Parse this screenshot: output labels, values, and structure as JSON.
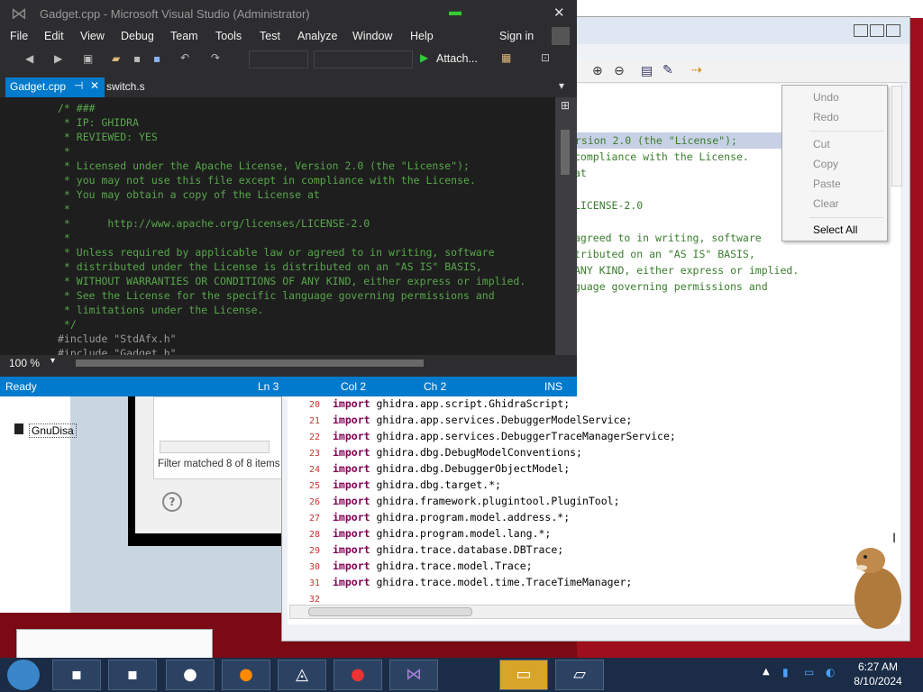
{
  "vs": {
    "title": "Gadget.cpp - Microsoft Visual Studio (Administrator)",
    "menu": [
      "File",
      "Edit",
      "View",
      "Debug",
      "Team",
      "Tools",
      "Test",
      "Analyze",
      "Window",
      "Help"
    ],
    "sign_in": "Sign in",
    "attach_label": "Attach...",
    "tabs": [
      {
        "label": "Gadget.cpp"
      },
      {
        "label": "switch.s"
      }
    ],
    "code_lines": [
      {
        "text": "/* ###",
        "cls": "cm"
      },
      {
        "text": " * IP: GHIDRA",
        "cls": "cm"
      },
      {
        "text": " * REVIEWED: YES",
        "cls": "cm"
      },
      {
        "text": " *",
        "cls": "cm"
      },
      {
        "text": " * Licensed under the Apache License, Version 2.0 (the \"License\");",
        "cls": "cm"
      },
      {
        "text": " * you may not use this file except in compliance with the License.",
        "cls": "cm"
      },
      {
        "text": " * You may obtain a copy of the License at",
        "cls": "cm"
      },
      {
        "text": " *",
        "cls": "cm"
      },
      {
        "text": " *      http://www.apache.org/licenses/LICENSE-2.0",
        "cls": "cm"
      },
      {
        "text": " *",
        "cls": "cm"
      },
      {
        "text": " * Unless required by applicable law or agreed to in writing, software",
        "cls": "cm"
      },
      {
        "text": " * distributed under the License is distributed on an \"AS IS\" BASIS,",
        "cls": "cm"
      },
      {
        "text": " * WITHOUT WARRANTIES OR CONDITIONS OF ANY KIND, either express or implied.",
        "cls": "cm"
      },
      {
        "text": " * See the License for the specific language governing permissions and",
        "cls": "cm"
      },
      {
        "text": " * limitations under the License.",
        "cls": "cm"
      },
      {
        "text": " */",
        "cls": "cm"
      },
      {
        "text": "#include \"StdAfx.h\"",
        "cls": "pp"
      },
      {
        "text": "#include \"Gadget.h\"",
        "cls": "pp"
      }
    ],
    "zoom": "100 %",
    "status": {
      "ready": "Ready",
      "ln": "Ln 3",
      "col": "Col 2",
      "ch": "Ch 2",
      "ins": "INS"
    }
  },
  "ghidra": {
    "top_fragments": [
      "ersion 2.0 (the \"License\");",
      "compliance with the License.",
      "at",
      "",
      "LICENSE-2.0",
      "",
      "agreed to in writing, software",
      "tributed on an \"AS IS\" BASIS,",
      "ANY KIND, either express or implied.",
      "guage governing permissions and"
    ],
    "import_lines": [
      {
        "n": "20",
        "kw": "import",
        "text": "ghidra.app.script.GhidraScript;"
      },
      {
        "n": "21",
        "kw": "import",
        "text": "ghidra.app.services.DebuggerModelService;"
      },
      {
        "n": "22",
        "kw": "import",
        "text": "ghidra.app.services.DebuggerTraceManagerService;"
      },
      {
        "n": "23",
        "kw": "import",
        "text": "ghidra.dbg.DebugModelConventions;"
      },
      {
        "n": "24",
        "kw": "import",
        "text": "ghidra.dbg.DebuggerObjectModel;"
      },
      {
        "n": "25",
        "kw": "import",
        "text": "ghidra.dbg.target.*;"
      },
      {
        "n": "26",
        "kw": "import",
        "text": "ghidra.framework.plugintool.PluginTool;"
      },
      {
        "n": "27",
        "kw": "import",
        "text": "ghidra.program.model.address.*;"
      },
      {
        "n": "28",
        "kw": "import",
        "text": "ghidra.program.model.lang.*;"
      },
      {
        "n": "29",
        "kw": "import",
        "text": "ghidra.trace.database.DBTrace;"
      },
      {
        "n": "30",
        "kw": "import",
        "text": "ghidra.trace.model.Trace;"
      },
      {
        "n": "31",
        "kw": "import",
        "text": "ghidra.trace.model.time.TraceTimeManager;"
      },
      {
        "n": "32",
        "kw": "",
        "text": ""
      }
    ]
  },
  "context_menu": {
    "undo": "Undo",
    "redo": "Redo",
    "cut": "Cut",
    "copy": "Copy",
    "paste": "Paste",
    "clear": "Clear",
    "select_all": "Select All"
  },
  "explorer": {
    "item_label": "GnuDisa",
    "filter_text": "Filter matched 8 of 8 items"
  },
  "taskbar": {
    "time": "6:27 AM",
    "date": "8/10/2024"
  }
}
